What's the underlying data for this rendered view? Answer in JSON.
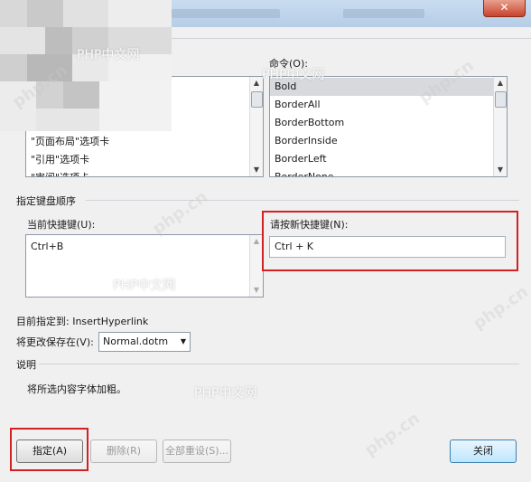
{
  "window": {
    "close_glyph": "✕"
  },
  "commands": {
    "label": "命令(O):",
    "items": [
      "Bold",
      "BorderAll",
      "BorderBottom",
      "BorderInside",
      "BorderLeft",
      "BorderNone"
    ],
    "selected": "Bold"
  },
  "categories": {
    "items": [
      "\"页面布局\"选项卡",
      "\"引用\"选项卡",
      "\"审阅\"选项卡"
    ]
  },
  "keyboard_group": {
    "title": "指定键盘顺序",
    "current_label": "当前快捷键(U):",
    "current_keys": [
      "Ctrl+B"
    ],
    "new_label": "请按新快捷键(N):",
    "new_value": "Ctrl + K"
  },
  "assigned": {
    "label": "目前指定到:",
    "value": "InsertHyperlink"
  },
  "save_in": {
    "label": "将更改保存在(V):",
    "value": "Normal.dotm"
  },
  "description": {
    "title": "说明",
    "text": "将所选内容字体加粗。"
  },
  "buttons": {
    "assign": "指定(A)",
    "remove": "删除(R)",
    "reset_all": "全部重设(S)...",
    "close": "关闭"
  },
  "watermarks": [
    "PHP中文网",
    "PHP中文网",
    "PHP中文网",
    "PHP中文网"
  ],
  "watermark_domain": "php.cn"
}
